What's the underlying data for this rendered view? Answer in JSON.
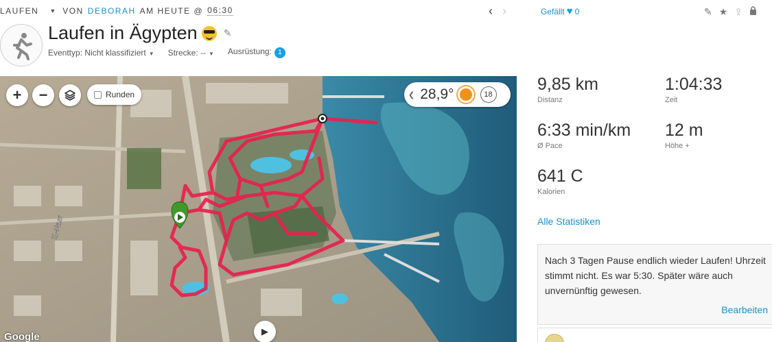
{
  "header": {
    "sport": "LAUFEN",
    "by": "VON",
    "user": "DEBORAH",
    "when": "AM HEUTE @",
    "time": "06:30"
  },
  "likes": {
    "label": "Gefällt",
    "count": "0"
  },
  "activity": {
    "title": "Laufen in Ägypten",
    "event_type": "Eventtyp: Nicht klassifiziert",
    "route": "Strecke: --",
    "gear_label": "Ausrüstung:",
    "gear_count": "1"
  },
  "map": {
    "laps_label": "Runden",
    "temperature": "28,9°",
    "wind": "18",
    "road_label": "El-Nasr",
    "attribution": "Google",
    "zoom_in": "+",
    "zoom_out": "−"
  },
  "stats": [
    {
      "value": "9,85 km",
      "label": "Distanz"
    },
    {
      "value": "1:04:33",
      "label": "Zeit"
    },
    {
      "value": "6:33 min/km",
      "label": "Ø Pace"
    },
    {
      "value": "12 m",
      "label": "Höhe +"
    },
    {
      "value": "641 C",
      "label": "Kalorien"
    }
  ],
  "all_stats_link": "Alle Statistiken",
  "note": {
    "text": "Nach 3 Tagen Pause endlich wieder Laufen! Uhrzeit stimmt nicht. Es war 5:30. Später wäre auch unvernünftig gewesen.",
    "edit": "Bearbeiten"
  },
  "colors": {
    "accent": "#1a8fc9",
    "route": "#e8214d",
    "sea": "#2b6f8e",
    "start_marker": "#3f9a2c"
  },
  "icons": [
    "chevron-left-icon",
    "chevron-right-icon",
    "heart-icon",
    "pencil-icon",
    "star-icon",
    "share-icon",
    "lock-icon",
    "runner-icon",
    "layers-icon",
    "sun-icon",
    "play-icon"
  ]
}
